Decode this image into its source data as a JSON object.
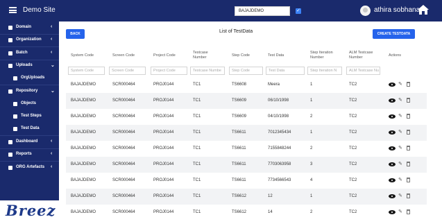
{
  "app": {
    "title": "Demo Site",
    "project_value": "BAJAJDEMO",
    "user_name": "athira sobhana",
    "brand": "Breez"
  },
  "sidebar": {
    "items": [
      {
        "label": "Domain",
        "chevron": "‹"
      },
      {
        "label": "Organization",
        "chevron": "‹"
      },
      {
        "label": "Batch",
        "chevron": "‹"
      },
      {
        "label": "Uploads",
        "chevron": "⌄"
      },
      {
        "label": "OrgUploads",
        "chevron": ""
      },
      {
        "label": "Repository",
        "chevron": "⌄"
      },
      {
        "label": "Objects",
        "chevron": ""
      },
      {
        "label": "Test Steps",
        "chevron": ""
      },
      {
        "label": "Test Data",
        "chevron": ""
      },
      {
        "label": "Dashboard",
        "chevron": "‹"
      },
      {
        "label": "Reports",
        "chevron": "‹"
      },
      {
        "label": "ORG Artefacts",
        "chevron": "‹"
      }
    ]
  },
  "page": {
    "back_label": "BACK",
    "title": "List of TestData",
    "create_label": "CREATE TESTDATA"
  },
  "table": {
    "headers": [
      "System Code",
      "Screen Code",
      "Project Code",
      "Testcase Number",
      "Step Code",
      "Test Data",
      "Step Iteration Number",
      "ALM Testcase Number",
      "Actions"
    ],
    "filters": [
      "System Code",
      "Screen Code",
      "Project Code",
      "Testcase Numbe",
      "Step Code",
      "Test Data",
      "Step Iteration N",
      "ALM Testcase Nu"
    ],
    "rows": [
      [
        "BAJAJDEMO",
        "SCR000464",
        "PROJ0144",
        "TC1",
        "TS6608",
        "Meera",
        "1",
        "TC2"
      ],
      [
        "BAJAJDEMO",
        "SCR000464",
        "PROJ0144",
        "TC1",
        "TS6609",
        "06/10/1998",
        "1",
        "TC2"
      ],
      [
        "BAJAJDEMO",
        "SCR000464",
        "PROJ0144",
        "TC1",
        "TS6609",
        "04/10/1998",
        "2",
        "TC2"
      ],
      [
        "BAJAJDEMO",
        "SCR000464",
        "PROJ0144",
        "TC1",
        "TS6611",
        "7012345434",
        "1",
        "TC2"
      ],
      [
        "BAJAJDEMO",
        "SCR000464",
        "PROJ0144",
        "TC1",
        "TS6611",
        "7155848244",
        "2",
        "TC2"
      ],
      [
        "BAJAJDEMO",
        "SCR000464",
        "PROJ0144",
        "TC1",
        "TS6611",
        "7703063958",
        "3",
        "TC2"
      ],
      [
        "BAJAJDEMO",
        "SCR000464",
        "PROJ0144",
        "TC1",
        "TS6611",
        "7734566543",
        "4",
        "TC2"
      ],
      [
        "BAJAJDEMO",
        "SCR000464",
        "PROJ0144",
        "TC1",
        "TS6612",
        "12",
        "1",
        "TC2"
      ],
      [
        "BAJAJDEMO",
        "SCR000464",
        "PROJ0144",
        "TC1",
        "TS6612",
        "14",
        "2",
        "TC2"
      ]
    ]
  },
  "colors": {
    "nav": "#1a2a6c",
    "accent": "#2563eb",
    "stripe": "#f2f3f5"
  }
}
